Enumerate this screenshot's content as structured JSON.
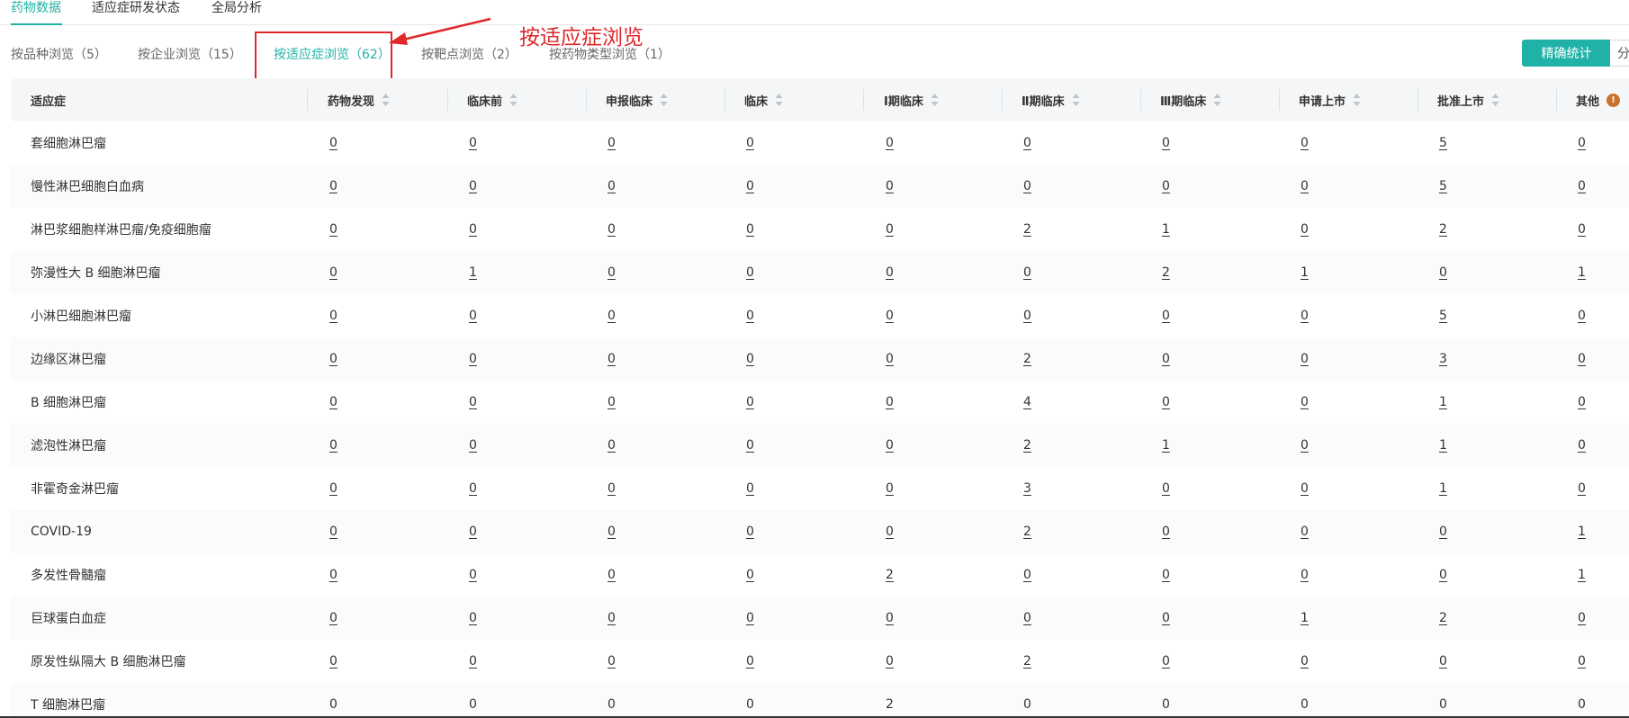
{
  "top_tabs": [
    {
      "label": "药物数据",
      "active": true
    },
    {
      "label": "适应症研发状态",
      "active": false
    },
    {
      "label": "全局分析",
      "active": false
    }
  ],
  "sub_tabs": [
    {
      "label": "按品种浏览（5）",
      "active": false
    },
    {
      "label": "按企业浏览（15）",
      "active": false
    },
    {
      "label": "按适应症浏览（62）",
      "active": true
    },
    {
      "label": "按靶点浏览（2）",
      "active": false
    },
    {
      "label": "按药物类型浏览（1）",
      "active": false
    }
  ],
  "annotation": {
    "label": "按适应症浏览"
  },
  "buttons": {
    "precise": "精确统计",
    "classify": "分类"
  },
  "colors": {
    "accent": "#21b2a7",
    "annotation": "#e0272a",
    "info": "#c8722c"
  },
  "table": {
    "headers": [
      "适应症",
      "药物发现",
      "临床前",
      "申报临床",
      "临床",
      "Ⅰ期临床",
      "Ⅱ期临床",
      "Ⅲ期临床",
      "申请上市",
      "批准上市",
      "其他"
    ],
    "rows": [
      {
        "name": "套细胞淋巴瘤",
        "values": [
          "0",
          "0",
          "0",
          "0",
          "0",
          "0",
          "0",
          "0",
          "5",
          "0"
        ]
      },
      {
        "name": "慢性淋巴细胞白血病",
        "values": [
          "0",
          "0",
          "0",
          "0",
          "0",
          "0",
          "0",
          "0",
          "5",
          "0"
        ]
      },
      {
        "name": "淋巴浆细胞样淋巴瘤/免疫细胞瘤",
        "values": [
          "0",
          "0",
          "0",
          "0",
          "0",
          "2",
          "1",
          "0",
          "2",
          "0"
        ]
      },
      {
        "name": "弥漫性大 B 细胞淋巴瘤",
        "values": [
          "0",
          "1",
          "0",
          "0",
          "0",
          "0",
          "2",
          "1",
          "0",
          "1"
        ]
      },
      {
        "name": "小淋巴细胞淋巴瘤",
        "values": [
          "0",
          "0",
          "0",
          "0",
          "0",
          "0",
          "0",
          "0",
          "5",
          "0"
        ]
      },
      {
        "name": "边缘区淋巴瘤",
        "values": [
          "0",
          "0",
          "0",
          "0",
          "0",
          "2",
          "0",
          "0",
          "3",
          "0"
        ]
      },
      {
        "name": "B 细胞淋巴瘤",
        "values": [
          "0",
          "0",
          "0",
          "0",
          "0",
          "4",
          "0",
          "0",
          "1",
          "0"
        ]
      },
      {
        "name": "滤泡性淋巴瘤",
        "values": [
          "0",
          "0",
          "0",
          "0",
          "0",
          "2",
          "1",
          "0",
          "1",
          "0"
        ]
      },
      {
        "name": "非霍奇金淋巴瘤",
        "values": [
          "0",
          "0",
          "0",
          "0",
          "0",
          "3",
          "0",
          "0",
          "1",
          "0"
        ]
      },
      {
        "name": "COVID-19",
        "values": [
          "0",
          "0",
          "0",
          "0",
          "0",
          "2",
          "0",
          "0",
          "0",
          "1"
        ]
      },
      {
        "name": "多发性骨髓瘤",
        "values": [
          "0",
          "0",
          "0",
          "0",
          "2",
          "0",
          "0",
          "0",
          "0",
          "1"
        ]
      },
      {
        "name": "巨球蛋白血症",
        "values": [
          "0",
          "0",
          "0",
          "0",
          "0",
          "0",
          "0",
          "1",
          "2",
          "0"
        ]
      },
      {
        "name": "原发性纵隔大 B 细胞淋巴瘤",
        "values": [
          "0",
          "0",
          "0",
          "0",
          "0",
          "2",
          "0",
          "0",
          "0",
          "0"
        ]
      },
      {
        "name": "T 细胞淋巴瘤",
        "values": [
          "0",
          "0",
          "0",
          "0",
          "2",
          "0",
          "0",
          "0",
          "0",
          "0"
        ]
      }
    ]
  }
}
